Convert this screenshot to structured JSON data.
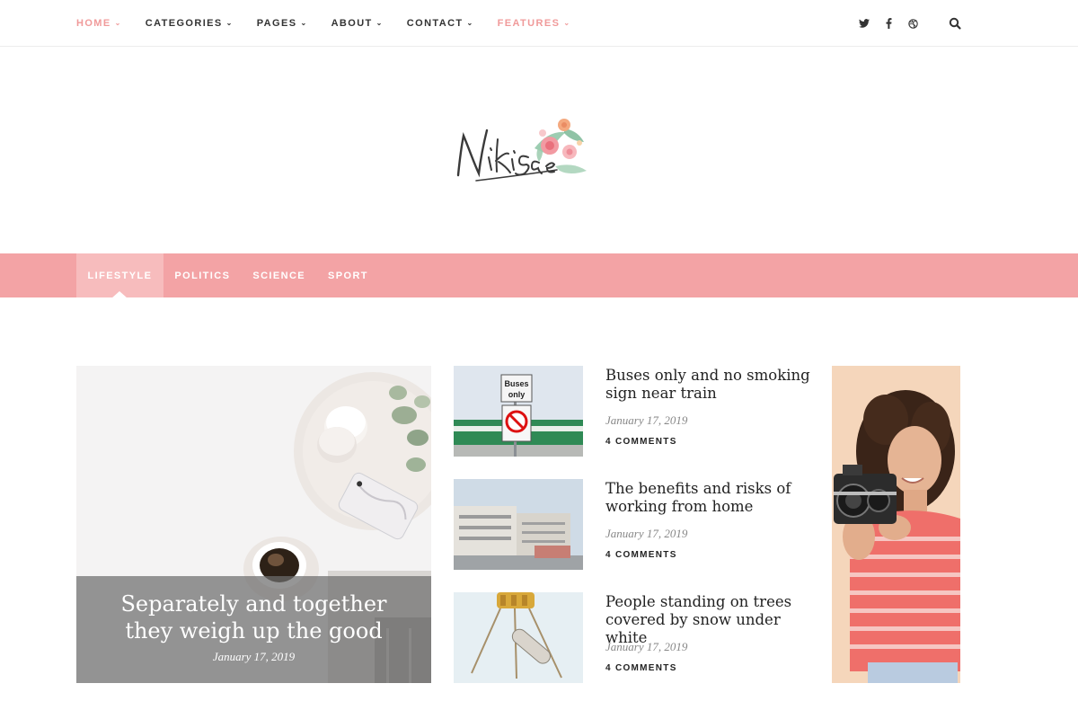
{
  "topnav": {
    "items": [
      {
        "label": "HOME",
        "accent": true
      },
      {
        "label": "CATEGORIES",
        "accent": false
      },
      {
        "label": "PAGES",
        "accent": false
      },
      {
        "label": "ABOUT",
        "accent": false
      },
      {
        "label": "CONTACT",
        "accent": false
      },
      {
        "label": "FEATURES",
        "accent": true
      }
    ],
    "social": [
      {
        "icon": "twitter-icon",
        "glyph": "t"
      },
      {
        "icon": "facebook-icon",
        "glyph": "f"
      },
      {
        "icon": "dribbble-icon",
        "glyph": "◎"
      }
    ],
    "search_icon": "search-icon"
  },
  "logo": {
    "text": "Nikisae"
  },
  "categories": {
    "items": [
      "LIFESTYLE",
      "POLITICS",
      "SCIENCE",
      "SPORT"
    ],
    "active": "LIFESTYLE"
  },
  "featured": {
    "title": "Separately and together they weigh up the good",
    "date": "January 17, 2019"
  },
  "posts": [
    {
      "title": "Buses only and no smoking sign near train",
      "date": "January 17, 2019",
      "comments": "4 COMMENTS"
    },
    {
      "title": "The benefits and risks of working from home",
      "date": "January 17, 2019",
      "comments": "4 COMMENTS"
    },
    {
      "title": "People standing on trees covered by snow under white",
      "date": "January 17, 2019",
      "comments": "4 COMMENTS"
    }
  ],
  "colors": {
    "accent": "#f09a9a",
    "category_bar": "#f3a3a5",
    "category_active": "#f7bcbd"
  }
}
